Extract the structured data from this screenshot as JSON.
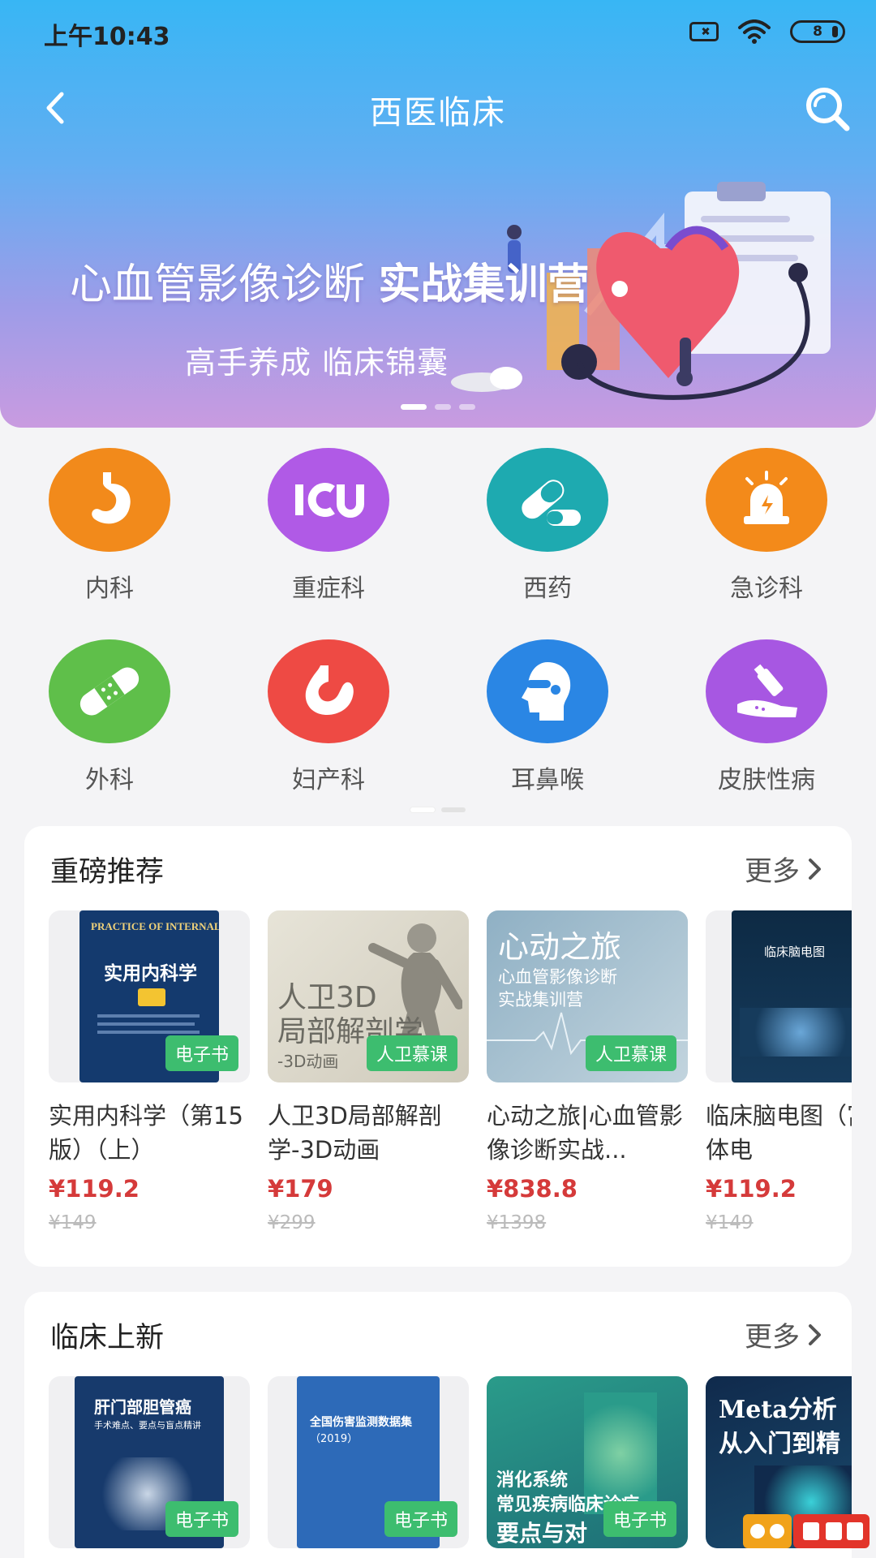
{
  "status": {
    "time": "上午10:43",
    "battery": "8"
  },
  "nav": {
    "title": "西医临床"
  },
  "banner": {
    "title_normal": "心血管影像诊断",
    "title_bold": "实战集训营",
    "subtitle": "高手养成   临床锦囊"
  },
  "categories": [
    {
      "label": "内科",
      "color": "#f28a1b",
      "icon": "stomach-icon"
    },
    {
      "label": "重症科",
      "color": "#b05ae6",
      "icon": "icu-icon"
    },
    {
      "label": "西药",
      "color": "#1eaab0",
      "icon": "pill-icon"
    },
    {
      "label": "急诊科",
      "color": "#f38a1a",
      "icon": "siren-icon"
    },
    {
      "label": "外科",
      "color": "#5fbf4a",
      "icon": "bandage-icon"
    },
    {
      "label": "妇产科",
      "color": "#ee4a44",
      "icon": "uterus-icon"
    },
    {
      "label": "耳鼻喉",
      "color": "#2a86e4",
      "icon": "head-icon"
    },
    {
      "label": "皮肤性病",
      "color": "#a757e2",
      "icon": "skin-cream-icon"
    }
  ],
  "recommend": {
    "title": "重磅推荐",
    "more": "更多",
    "books": [
      {
        "name": "实用内科学（第15版）（上）",
        "price": "¥119.2",
        "old": "¥149",
        "badge": "电子书",
        "cover_title": "实用内科学",
        "cover_en": "PRACTICE OF INTERNAL MEDICINE"
      },
      {
        "name": "人卫3D局部解剖学-3D动画",
        "price": "¥179",
        "old": "¥299",
        "badge": "人卫慕课",
        "cover_title": "人卫3D",
        "cover_title2": "局部解剖学",
        "cover_sub": "-3D动画"
      },
      {
        "name": "心动之旅|心血管影像诊断实战...",
        "price": "¥838.8",
        "old": "¥1398",
        "badge": "人卫慕课",
        "cover_title": "心动之旅",
        "cover_sub": "心血管影像诊断",
        "cover_sub2": "实战集训营"
      },
      {
        "name": "临床脑电图（富媒体电",
        "price": "¥119.2",
        "old": "¥149",
        "badge": "",
        "cover_title": "临床脑电图"
      }
    ]
  },
  "newest": {
    "title": "临床上新",
    "more": "更多",
    "books": [
      {
        "badge": "电子书",
        "cover_title": "肝门部胆管癌",
        "cover_sub": "手术难点、要点与盲点精讲"
      },
      {
        "badge": "电子书",
        "cover_title": "全国伤害监测数据集",
        "cover_sub": "（2019）"
      },
      {
        "badge": "电子书",
        "cover_title": "消化系统",
        "cover_sub": "常见疾病临床诊疗",
        "cover_sub2": "要点与对"
      },
      {
        "badge": "",
        "cover_title": "Meta分析",
        "cover_sub": "从入门到精"
      }
    ]
  }
}
